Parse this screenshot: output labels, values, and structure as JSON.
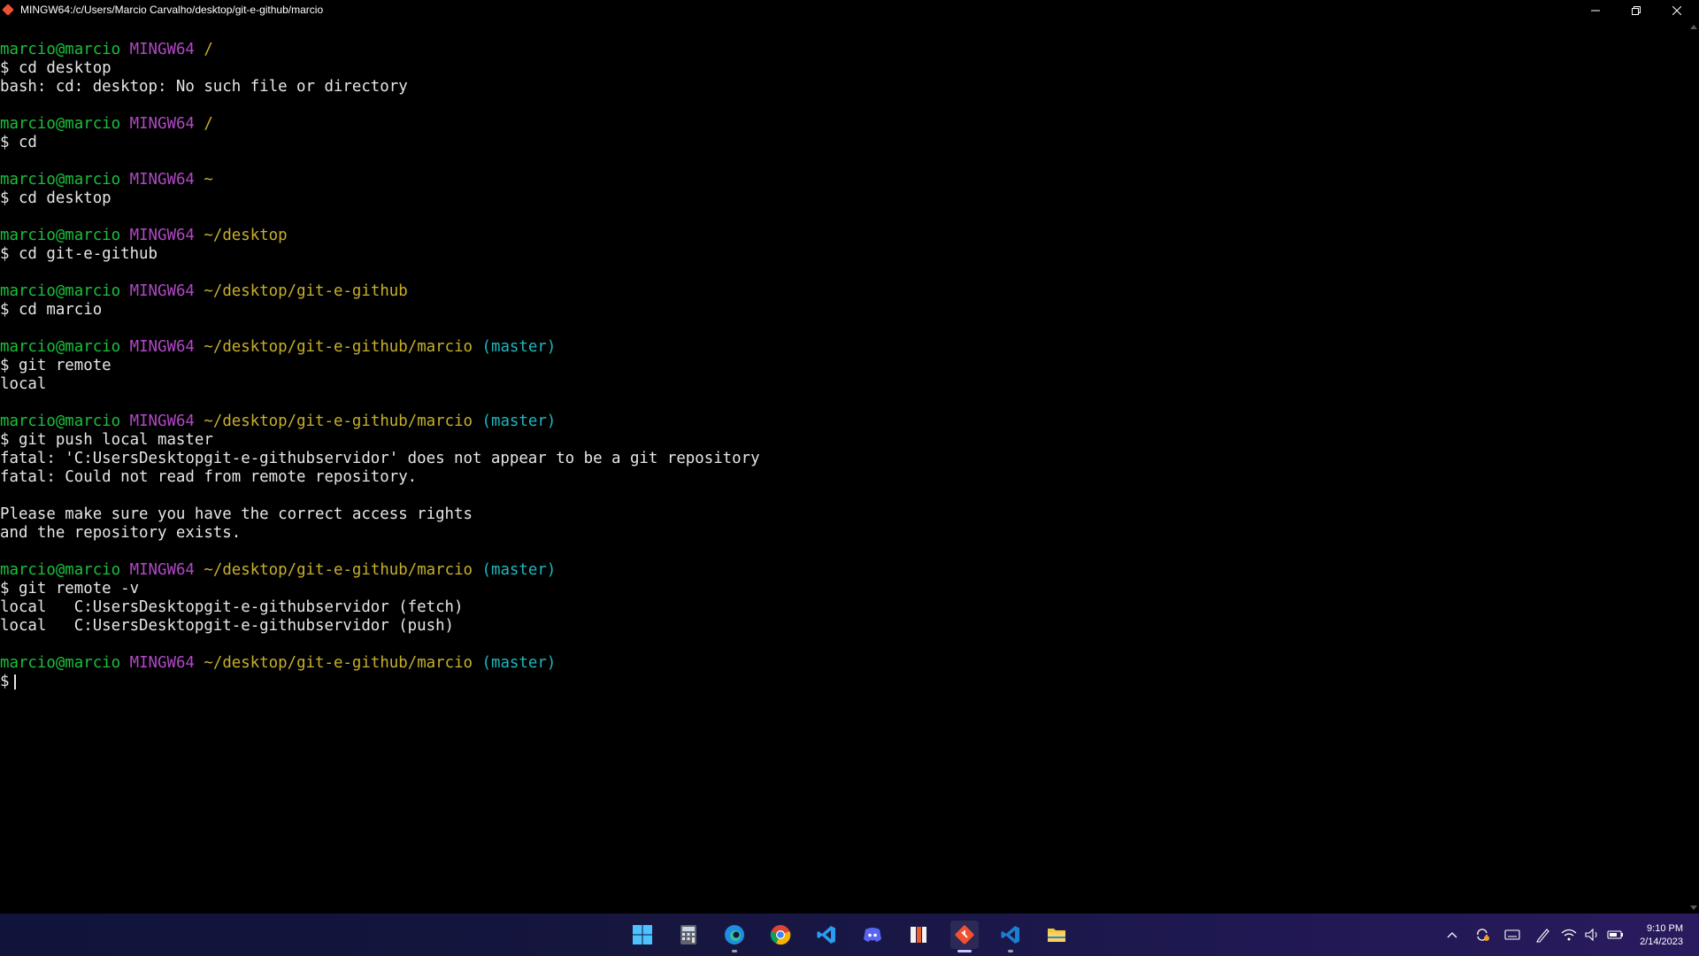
{
  "window": {
    "title": "MINGW64:/c/Users/Marcio Carvalho/desktop/git-e-github/marcio"
  },
  "terminal": {
    "lines": [
      {
        "segs": [
          {
            "t": "marcio@marcio",
            "c": "user"
          },
          {
            "t": " "
          },
          {
            "t": "MINGW64",
            "c": "host"
          },
          {
            "t": " "
          },
          {
            "t": "/",
            "c": "path"
          }
        ]
      },
      {
        "segs": [
          {
            "t": "$ cd desktop"
          }
        ]
      },
      {
        "segs": [
          {
            "t": "bash: cd: desktop: No such file or directory"
          }
        ]
      },
      {
        "segs": []
      },
      {
        "segs": [
          {
            "t": "marcio@marcio",
            "c": "user"
          },
          {
            "t": " "
          },
          {
            "t": "MINGW64",
            "c": "host"
          },
          {
            "t": " "
          },
          {
            "t": "/",
            "c": "path"
          }
        ]
      },
      {
        "segs": [
          {
            "t": "$ cd"
          }
        ]
      },
      {
        "segs": []
      },
      {
        "segs": [
          {
            "t": "marcio@marcio",
            "c": "user"
          },
          {
            "t": " "
          },
          {
            "t": "MINGW64",
            "c": "host"
          },
          {
            "t": " "
          },
          {
            "t": "~",
            "c": "path"
          }
        ]
      },
      {
        "segs": [
          {
            "t": "$ cd desktop"
          }
        ]
      },
      {
        "segs": []
      },
      {
        "segs": [
          {
            "t": "marcio@marcio",
            "c": "user"
          },
          {
            "t": " "
          },
          {
            "t": "MINGW64",
            "c": "host"
          },
          {
            "t": " "
          },
          {
            "t": "~/desktop",
            "c": "path"
          }
        ]
      },
      {
        "segs": [
          {
            "t": "$ cd git-e-github"
          }
        ]
      },
      {
        "segs": []
      },
      {
        "segs": [
          {
            "t": "marcio@marcio",
            "c": "user"
          },
          {
            "t": " "
          },
          {
            "t": "MINGW64",
            "c": "host"
          },
          {
            "t": " "
          },
          {
            "t": "~/desktop/git-e-github",
            "c": "path"
          }
        ]
      },
      {
        "segs": [
          {
            "t": "$ cd marcio"
          }
        ]
      },
      {
        "segs": []
      },
      {
        "segs": [
          {
            "t": "marcio@marcio",
            "c": "user"
          },
          {
            "t": " "
          },
          {
            "t": "MINGW64",
            "c": "host"
          },
          {
            "t": " "
          },
          {
            "t": "~/desktop/git-e-github/marcio",
            "c": "path"
          },
          {
            "t": " "
          },
          {
            "t": "(master)",
            "c": "branch"
          }
        ]
      },
      {
        "segs": [
          {
            "t": "$ git remote"
          }
        ]
      },
      {
        "segs": [
          {
            "t": "local"
          }
        ]
      },
      {
        "segs": []
      },
      {
        "segs": [
          {
            "t": "marcio@marcio",
            "c": "user"
          },
          {
            "t": " "
          },
          {
            "t": "MINGW64",
            "c": "host"
          },
          {
            "t": " "
          },
          {
            "t": "~/desktop/git-e-github/marcio",
            "c": "path"
          },
          {
            "t": " "
          },
          {
            "t": "(master)",
            "c": "branch"
          }
        ]
      },
      {
        "segs": [
          {
            "t": "$ git push local master"
          }
        ]
      },
      {
        "segs": [
          {
            "t": "fatal: 'C:UsersDesktopgit-e-githubservidor' does not appear to be a git repository"
          }
        ]
      },
      {
        "segs": [
          {
            "t": "fatal: Could not read from remote repository."
          }
        ]
      },
      {
        "segs": []
      },
      {
        "segs": [
          {
            "t": "Please make sure you have the correct access rights"
          }
        ]
      },
      {
        "segs": [
          {
            "t": "and the repository exists."
          }
        ]
      },
      {
        "segs": []
      },
      {
        "segs": [
          {
            "t": "marcio@marcio",
            "c": "user"
          },
          {
            "t": " "
          },
          {
            "t": "MINGW64",
            "c": "host"
          },
          {
            "t": " "
          },
          {
            "t": "~/desktop/git-e-github/marcio",
            "c": "path"
          },
          {
            "t": " "
          },
          {
            "t": "(master)",
            "c": "branch"
          }
        ]
      },
      {
        "segs": [
          {
            "t": "$ git remote -v"
          }
        ]
      },
      {
        "segs": [
          {
            "t": "local   C:UsersDesktopgit-e-githubservidor (fetch)"
          }
        ]
      },
      {
        "segs": [
          {
            "t": "local   C:UsersDesktopgit-e-githubservidor (push)"
          }
        ]
      },
      {
        "segs": []
      },
      {
        "segs": [
          {
            "t": "marcio@marcio",
            "c": "user"
          },
          {
            "t": " "
          },
          {
            "t": "MINGW64",
            "c": "host"
          },
          {
            "t": " "
          },
          {
            "t": "~/desktop/git-e-github/marcio",
            "c": "path"
          },
          {
            "t": " "
          },
          {
            "t": "(master)",
            "c": "branch"
          }
        ]
      },
      {
        "segs": [
          {
            "t": "$"
          }
        ],
        "cursor": true
      }
    ]
  },
  "taskbar": {
    "apps": [
      "start-icon",
      "calculator-icon",
      "edge-icon",
      "chrome-icon",
      "vscode-icon",
      "discord-icon",
      "office-icon",
      "git-bash-icon",
      "vscode-insiders-icon",
      "file-explorer-icon"
    ],
    "active_app": "git-bash-icon",
    "tray_icons": [
      "chevron-up-icon",
      "sync-icon",
      "keyboard-icon",
      "pen-icon",
      "wifi-icon",
      "volume-icon",
      "battery-icon"
    ],
    "clock": {
      "time": "9:10 PM",
      "date": "2/14/2023"
    }
  },
  "colors": {
    "user": "#19c13c",
    "host": "#b148c6",
    "path": "#c8b02a",
    "branch": "#1db8bf",
    "text": "#e6e6e6"
  }
}
